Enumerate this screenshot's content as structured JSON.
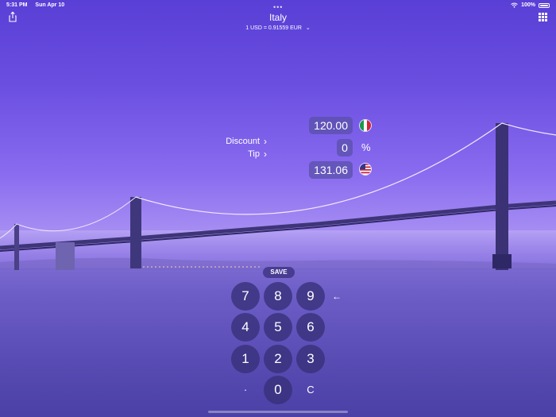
{
  "status_bar": {
    "time": "5:31 PM",
    "date": "Sun Apr 10",
    "battery": "100%"
  },
  "header": {
    "top_dots": "•••",
    "title": "Italy",
    "rate": "1 USD = 0.91559 EUR",
    "rate_chevron": "⌄"
  },
  "side_links": [
    {
      "label": "Discount",
      "arrow": "›"
    },
    {
      "label": "Tip",
      "arrow": "›"
    }
  ],
  "values": {
    "foreign_amount": "120.00",
    "percent_value": "0",
    "percent_sign": "%",
    "home_amount": "131.06"
  },
  "flags": {
    "top": "flag-italy-icon",
    "bottom": "flag-usa-icon"
  },
  "keypad": {
    "save_label": "SAVE",
    "keys": [
      "7",
      "8",
      "9",
      "←",
      "4",
      "5",
      "6",
      "1",
      "2",
      "3",
      "·",
      "0",
      "C"
    ]
  },
  "colors": {
    "sky_top": "#5a3fd6",
    "sky_mid": "#a58cf2",
    "water": "#3a3290",
    "key_bg": "#37307a"
  }
}
